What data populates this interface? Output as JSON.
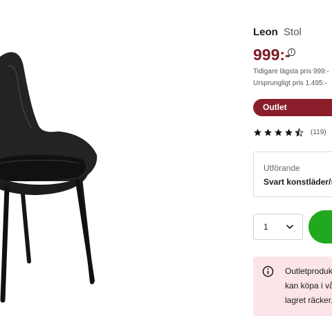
{
  "product": {
    "name": "Leon",
    "type": "Stol",
    "price": "999:-",
    "lowest_price_note": "Tidigare lägsta pris 999:-",
    "original_price_note": "Ursprungligt pris 1.495:-",
    "badge": "Outlet",
    "rating_stars": 4.5,
    "review_count": "(119)"
  },
  "variant": {
    "label": "Utförande",
    "value": "Svart konstläder/s"
  },
  "quantity": {
    "value": "1"
  },
  "notice": {
    "line1": "Outletprodukt",
    "line2": "kan köpa i vå",
    "line3": "lagret räcker."
  },
  "colors": {
    "price": "#7d1a24",
    "badge": "#8a1f2b",
    "cart_button": "#22a81e",
    "notice_bg": "#fbe5e8"
  },
  "icons": {
    "info": "info-icon",
    "star": "star-icon",
    "chevron": "chevron-down-icon"
  }
}
